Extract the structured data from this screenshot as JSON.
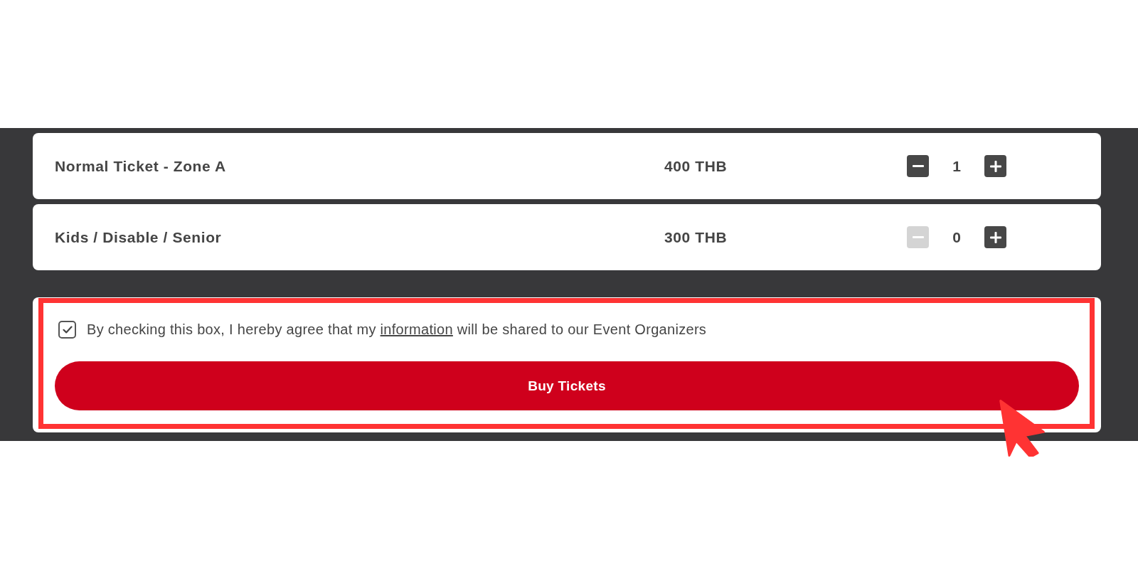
{
  "tickets": [
    {
      "name": "Normal Ticket - Zone A",
      "price": "400 THB",
      "quantity": "1",
      "decrease_disabled": false
    },
    {
      "name": "Kids / Disable / Senior",
      "price": "300 THB",
      "quantity": "0",
      "decrease_disabled": true
    }
  ],
  "consent": {
    "checked": true,
    "text_before": "By checking this box, I hereby agree that my ",
    "link": "information",
    "text_after": " will be shared to our Event Organizers"
  },
  "buy_button": {
    "label": "Buy Tickets"
  },
  "overlay": {
    "highlight_frame": true,
    "pointer": true
  }
}
